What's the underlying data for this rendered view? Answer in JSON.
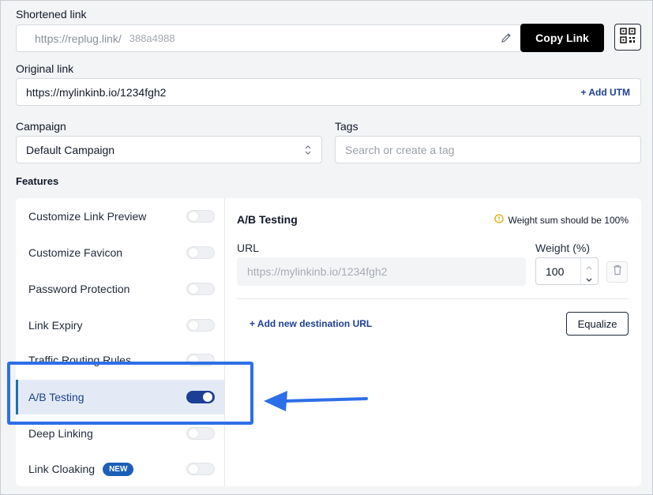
{
  "shortened": {
    "label": "Shortened link",
    "domain": "https://replug.link/",
    "slug": "388a4988",
    "copy_label": "Copy Link"
  },
  "original": {
    "label": "Original link",
    "value": "https://mylinkinb.io/1234fgh2",
    "add_utm": "+ Add UTM"
  },
  "campaign": {
    "label": "Campaign",
    "value": "Default Campaign"
  },
  "tags": {
    "label": "Tags",
    "placeholder": "Search or create a tag"
  },
  "features": {
    "label": "Features",
    "items": [
      {
        "label": "Customize Link Preview",
        "on": false
      },
      {
        "label": "Customize Favicon",
        "on": false
      },
      {
        "label": "Password Protection",
        "on": false
      },
      {
        "label": "Link Expiry",
        "on": false
      },
      {
        "label": "Traffic Routing Rules",
        "on": false
      },
      {
        "label": "A/B Testing",
        "on": true
      },
      {
        "label": "Deep Linking",
        "on": false
      },
      {
        "label": "Link Cloaking",
        "on": false,
        "badge": "NEW"
      }
    ]
  },
  "ab": {
    "title": "A/B Testing",
    "warning": "Weight sum should be 100%",
    "url_label": "URL",
    "url_placeholder": "https://mylinkinb.io/1234fgh2",
    "weight_label": "Weight (%)",
    "weight_value": "100",
    "add_destination": "+ Add new destination URL",
    "equalize": "Equalize"
  },
  "colors": {
    "accent": "#1c3f95",
    "highlight": "#2563eb",
    "selected_bg": "#e4eaf5",
    "warning": "#e0a800"
  }
}
